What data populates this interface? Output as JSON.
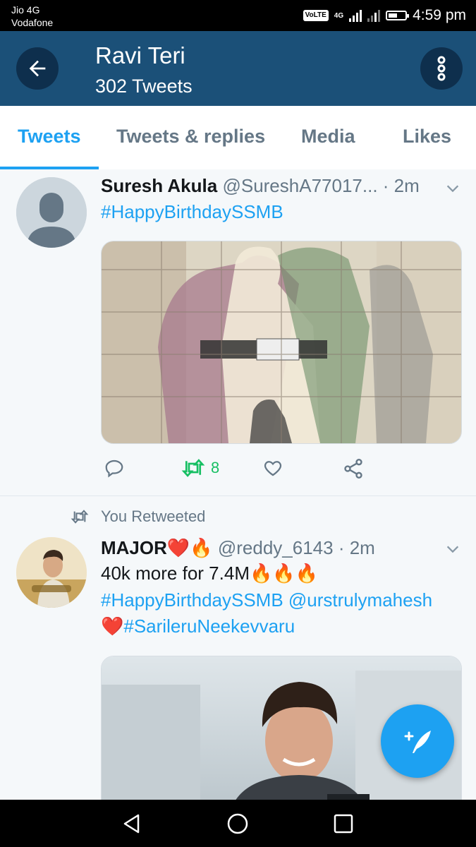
{
  "status_bar": {
    "carrier_1": "Jio 4G",
    "carrier_2": "Vodafone",
    "volte": "VoLTE",
    "network": "4G",
    "time": "4:59 pm"
  },
  "header": {
    "title": "Ravi Teri",
    "subtitle": "302 Tweets"
  },
  "tabs": [
    {
      "label": "Tweets",
      "active": true
    },
    {
      "label": "Tweets & replies",
      "active": false
    },
    {
      "label": "Media",
      "active": false
    },
    {
      "label": "Likes",
      "active": false
    }
  ],
  "tweets": [
    {
      "name": "Suresh Akula",
      "handle": "@SureshA77017...",
      "time": "· 2m",
      "text_1": "#HappyBirthdaySSMB",
      "retweet_count": "8"
    },
    {
      "retweeted_label": "You Retweeted",
      "name": "MAJOR❤️🔥",
      "handle": "@reddy_6143",
      "time": "· 2m",
      "text_1": "40k more for 7.4M🔥🔥🔥",
      "text_2": "#HappyBirthdaySSMB @urstrulymahesh",
      "text_3_emoji": "❤️",
      "text_3_tag": "#SarileruNeekevvaru"
    }
  ],
  "colors": {
    "accent": "#1da1f2",
    "header_bg": "#1b5078",
    "retweet_green": "#17bf63"
  }
}
